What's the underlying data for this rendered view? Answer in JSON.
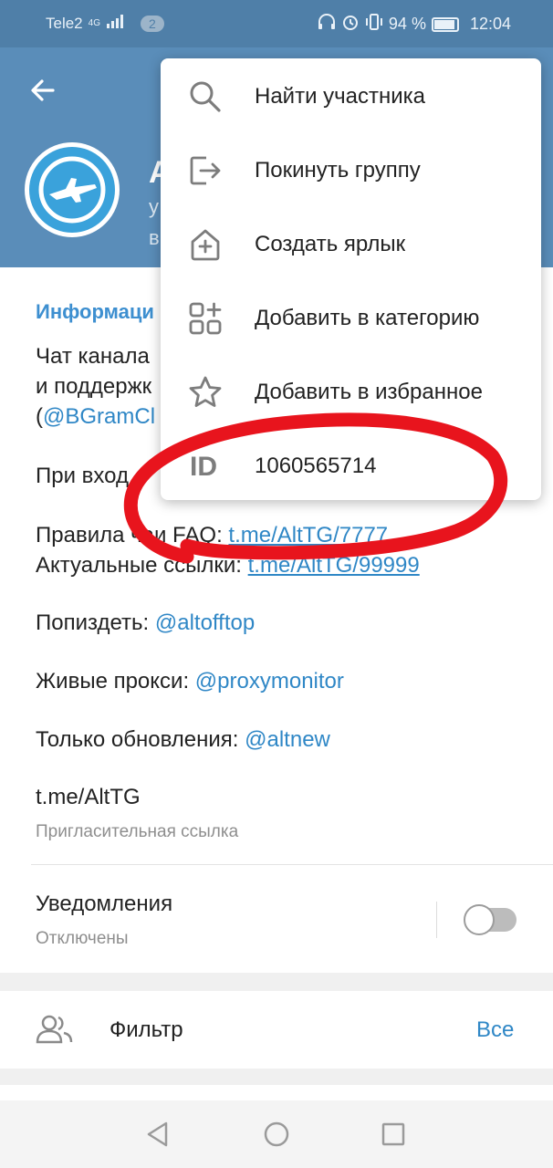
{
  "status_bar": {
    "carrier": "Tele2",
    "network": "4G",
    "notif_count": "2",
    "battery": "94 %",
    "time": "12:04"
  },
  "header": {
    "title": "A",
    "subtitle_line1": "у",
    "subtitle_line2": "в"
  },
  "info": {
    "title": "Информаци",
    "line1": "Чат канала",
    "line2": "и поддержк",
    "line3_prefix": "(",
    "line3_link": "@BGramCl",
    "line4": "При вход",
    "rules_prefix": "Правила ча",
    "rules_mid": "и FAQ: ",
    "rules_link": "t.me/AltTG/7777",
    "links_prefix": "Актуальные ссылки: ",
    "links_link": "t.me/AltTG/99999",
    "offtop_label": "Попиздеть: ",
    "offtop_link": "@altofftop",
    "proxy_label": "Живые прокси: ",
    "proxy_link": "@proxymonitor",
    "updates_label": "Только обновления: ",
    "updates_link": "@altnew",
    "invite_link": "t.me/AltTG",
    "invite_caption": "Пригласительная ссылка"
  },
  "notifications": {
    "label": "Уведомления",
    "status": "Отключены",
    "enabled": false
  },
  "filter": {
    "label": "Фильтр",
    "value": "Все"
  },
  "menu": {
    "items": [
      {
        "label": "Найти участника",
        "icon": "search-icon"
      },
      {
        "label": "Покинуть группу",
        "icon": "leave-icon"
      },
      {
        "label": "Создать ярлык",
        "icon": "shortcut-icon"
      },
      {
        "label": "Добавить в категорию",
        "icon": "category-icon"
      },
      {
        "label": "Добавить в избранное",
        "icon": "star-icon"
      }
    ],
    "id_icon_text": "ID",
    "id_value": "1060565714"
  },
  "colors": {
    "header": "#5a8db9",
    "status_bar": "#4f7fa8",
    "link": "#2f87c6",
    "accent_title": "#3d8fd0",
    "scribble": "#e8141d"
  }
}
